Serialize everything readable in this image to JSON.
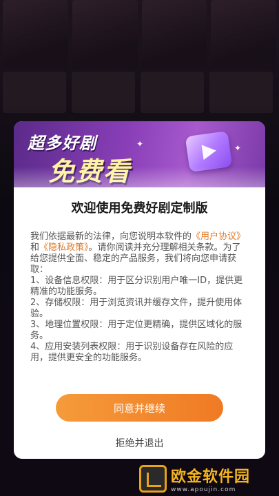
{
  "background": {
    "captions": [
      "",
      "",
      "",
      ""
    ]
  },
  "banner": {
    "line1": "超多好剧",
    "line2": "免费看"
  },
  "dialog": {
    "title": "欢迎使用免费好剧定制版",
    "intro_before": "我们依据最新的法律，向您说明本软件的",
    "link_user": "《用户协议》",
    "intro_and": "和",
    "link_privacy": "《隐私政策》",
    "intro_after": "。请你阅读并充分理解相关条款。为了给您提供全面、稳定的产品服务，我们将向您申请获取：",
    "items": [
      "1、设备信息权限：用于区分识别用户唯一ID，提供更精准的功能服务。",
      "2、存储权限：用于浏览资讯并缓存文件，提升使用体验。",
      "3、地理位置权限：用于定位更精确，提供区域化的服务。",
      "4、应用安装列表权限：用于识别设备存在风险的应用，提供更安全的功能服务。"
    ],
    "agree_label": "同意并继续",
    "reject_label": "拒绝并退出"
  },
  "watermark": {
    "name": "欧金软件园",
    "url": "www.apoujin.com"
  },
  "colors": {
    "accent": "#f07a24",
    "link": "#e07a2a",
    "banner": "#8a3fb8"
  }
}
